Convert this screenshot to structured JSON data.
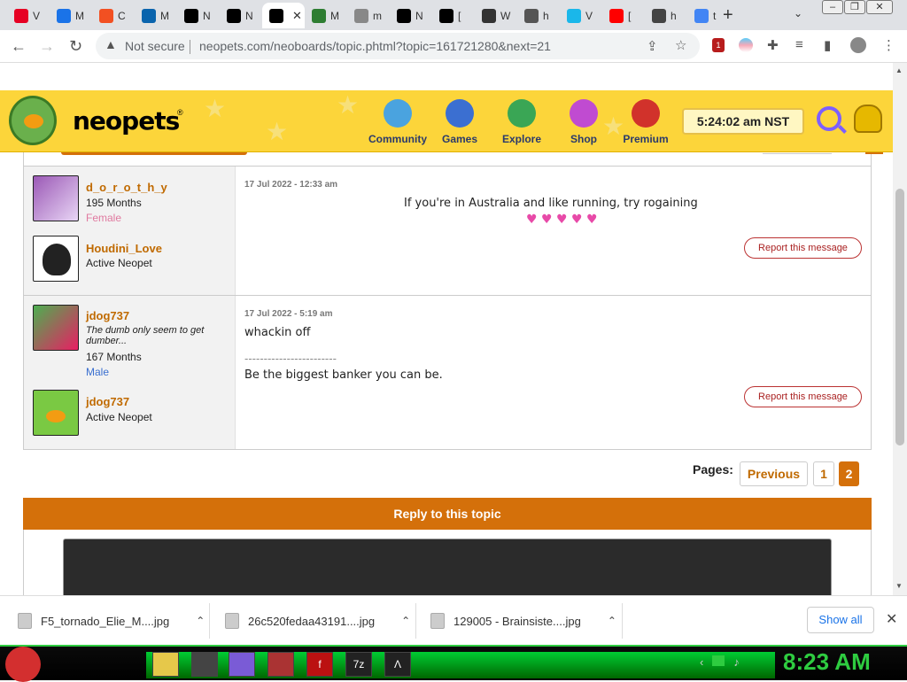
{
  "browser": {
    "tabs": [
      {
        "label": "V",
        "icon": "pinterest-icon",
        "color": "#e60023"
      },
      {
        "label": "M",
        "icon": "email-icon",
        "color": "#1a73e8"
      },
      {
        "label": "C",
        "icon": "windows-icon",
        "color": "#f25022"
      },
      {
        "label": "M",
        "icon": "outlook-icon",
        "color": "#0a64ad"
      },
      {
        "label": "N",
        "icon": "star-icon",
        "color": "#000000"
      },
      {
        "label": "N",
        "icon": "star-icon",
        "color": "#000000"
      },
      {
        "label": "",
        "icon": "star-icon",
        "color": "#000000"
      },
      {
        "label": "M",
        "icon": "mickey-icon",
        "color": "#2e7d32"
      },
      {
        "label": "m",
        "icon": "at-icon",
        "color": "#888888"
      },
      {
        "label": "N",
        "icon": "star-icon",
        "color": "#000000"
      },
      {
        "label": "[",
        "icon": "h-icon",
        "color": "#000000"
      },
      {
        "label": "W",
        "icon": "clapper-icon",
        "color": "#333333"
      },
      {
        "label": "h",
        "icon": "globe-icon",
        "color": "#555555"
      },
      {
        "label": "V",
        "icon": "v-icon",
        "color": "#1ab7ea"
      },
      {
        "label": "[",
        "icon": "youtube-icon",
        "color": "#ff0000"
      },
      {
        "label": "h",
        "icon": "eye-icon",
        "color": "#444444"
      },
      {
        "label": "t",
        "icon": "google-icon",
        "color": "#4285f4"
      }
    ],
    "new_tab": "+",
    "tab_list": "⌄",
    "window_controls": [
      "–",
      "❐",
      "✕"
    ],
    "nav": {
      "back": "←",
      "forward": "→",
      "reload": "↻"
    },
    "security": "Not secure",
    "url": "neopets.com/neoboards/topic.phtml?topic=161721280&next=21",
    "ext_badge": "1"
  },
  "neopets": {
    "logo": "neopets",
    "nav": [
      {
        "label": "Community",
        "color": "#4aa3df"
      },
      {
        "label": "Games",
        "color": "#3b6fd1"
      },
      {
        "label": "Explore",
        "color": "#3aa655"
      },
      {
        "label": "Shop",
        "color": "#c04bd1"
      },
      {
        "label": "Premium",
        "color": "#d1322b"
      }
    ],
    "clock": "5:24:02 am NST"
  },
  "posts": [
    {
      "author": "d_o_r_o_t_h_y",
      "months": "195 Months",
      "gender": "Female",
      "pet_name": "Houdini_Love",
      "pet_status": "Active Neopet",
      "date": "17 Jul 2022 - 12:33 am",
      "text": "If you're in Australia and like running, try rogaining",
      "hearts": "♥ ♥ ♥ ♥ ♥",
      "report": "Report this message"
    },
    {
      "author": "jdog737",
      "tagline": "The dumb only seem to get dumber...",
      "months": "167 Months",
      "gender": "Male",
      "pet_name": "jdog737",
      "pet_status": "Active Neopet",
      "date": "17 Jul 2022 - 5:19 am",
      "text": "whackin off",
      "divider": "------------------------",
      "signature": "Be the biggest banker you can be.",
      "report": "Report this message"
    }
  ],
  "pagination": {
    "label": "Pages:",
    "previous": "Previous",
    "pages": [
      "1",
      "2"
    ],
    "current": "2"
  },
  "reply": {
    "label": "Reply to this topic"
  },
  "downloads": {
    "items": [
      {
        "name": "F5_tornado_Elie_M....jpg"
      },
      {
        "name": "26c520fedaa43191....jpg"
      },
      {
        "name": "129005 - Brainsiste....jpg"
      }
    ],
    "show_all": "Show all",
    "close": "✕"
  },
  "taskbar": {
    "apps": [
      "folder-icon",
      "chrome-icon",
      "firefox-icon",
      "game-icon",
      "flash-icon",
      "7z-icon",
      "vector-icon"
    ],
    "app_labels": [
      "",
      "",
      "",
      "",
      "f",
      "7z",
      "Λ"
    ],
    "clock": "8:23 AM"
  }
}
